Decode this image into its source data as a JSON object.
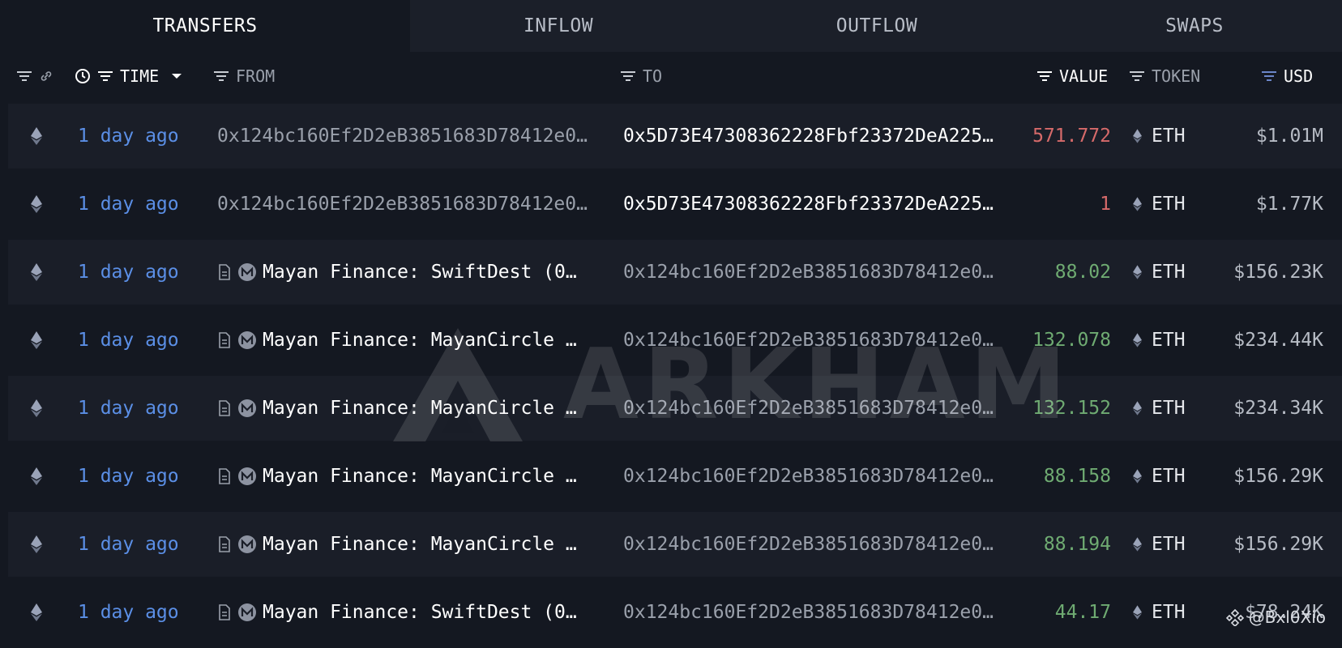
{
  "tabs": [
    {
      "label": "TRANSFERS",
      "active": true
    },
    {
      "label": "INFLOW",
      "active": false
    },
    {
      "label": "OUTFLOW",
      "active": false
    },
    {
      "label": "SWAPS",
      "active": false
    }
  ],
  "header": {
    "time": "TIME",
    "from": "FROM",
    "to": "TO",
    "value": "VALUE",
    "token": "TOKEN",
    "usd": "USD"
  },
  "rows": [
    {
      "time": "1 day ago",
      "from": "0x124bc160Ef2D2eB3851683D78412e0…",
      "to": "0x5D73E47308362228Fbf23372DeA225…",
      "value": "571.772",
      "token": "ETH",
      "usd": "$1.01M"
    },
    {
      "time": "1 day ago",
      "from": "0x124bc160Ef2D2eB3851683D78412e0…",
      "to": "0x5D73E47308362228Fbf23372DeA225…",
      "value": "1",
      "token": "ETH",
      "usd": "$1.77K"
    },
    {
      "time": "1 day ago",
      "from": "Mayan Finance: SwiftDest (0…",
      "to": "0x124bc160Ef2D2eB3851683D78412e0…",
      "value": "88.02",
      "token": "ETH",
      "usd": "$156.23K"
    },
    {
      "time": "1 day ago",
      "from": "Mayan Finance: MayanCircle …",
      "to": "0x124bc160Ef2D2eB3851683D78412e0…",
      "value": "132.078",
      "token": "ETH",
      "usd": "$234.44K"
    },
    {
      "time": "1 day ago",
      "from": "Mayan Finance: MayanCircle …",
      "to": "0x124bc160Ef2D2eB3851683D78412e0…",
      "value": "132.152",
      "token": "ETH",
      "usd": "$234.34K"
    },
    {
      "time": "1 day ago",
      "from": "Mayan Finance: MayanCircle …",
      "to": "0x124bc160Ef2D2eB3851683D78412e0…",
      "value": "88.158",
      "token": "ETH",
      "usd": "$156.29K"
    },
    {
      "time": "1 day ago",
      "from": "Mayan Finance: MayanCircle …",
      "to": "0x124bc160Ef2D2eB3851683D78412e0…",
      "value": "88.194",
      "token": "ETH",
      "usd": "$156.29K"
    },
    {
      "time": "1 day ago",
      "from": "Mayan Finance: SwiftDest (0…",
      "to": "0x124bc160Ef2D2eB3851683D78412e0…",
      "value": "44.17",
      "token": "ETH",
      "usd": "$78.24K"
    }
  ],
  "watermark": "ARKHAM",
  "credit": "@Bxl0Xio",
  "colors": {
    "background": "#141821",
    "row_alt": "#1a1e28",
    "time_link": "#5b8fe6",
    "value_out": "#d66a6a",
    "value_in": "#6fab72"
  }
}
